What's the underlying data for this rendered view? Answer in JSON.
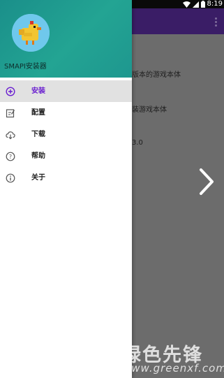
{
  "status_bar": {
    "time": "8:19",
    "icons": [
      "wifi-icon",
      "cellular-signal-icon",
      "battery-icon"
    ]
  },
  "drawer": {
    "header": {
      "app_name": "SMAPI安装器",
      "avatar_icon": "chicken-avatar-icon",
      "gradient_start": "#1a8f8a",
      "gradient_end": "#1e978f"
    },
    "items": [
      {
        "label": "安装",
        "icon": "add-circle-icon",
        "selected": true
      },
      {
        "label": "配置",
        "icon": "edit-document-icon",
        "selected": false
      },
      {
        "label": "下载",
        "icon": "cloud-download-icon",
        "selected": false
      },
      {
        "label": "帮助",
        "icon": "help-circle-icon",
        "selected": false
      },
      {
        "label": "关于",
        "icon": "info-circle-icon",
        "selected": false
      }
    ],
    "accent_color": "#6a1fd0"
  },
  "background": {
    "toolbar_color": "#3a1d66",
    "lines": [
      "版本的游戏本体",
      "装游戏本体",
      "3.0"
    ],
    "next_arrow_icon": "chevron-right-icon"
  },
  "watermark": {
    "text": "绿色先锋",
    "url": "www.greenxf.com"
  }
}
